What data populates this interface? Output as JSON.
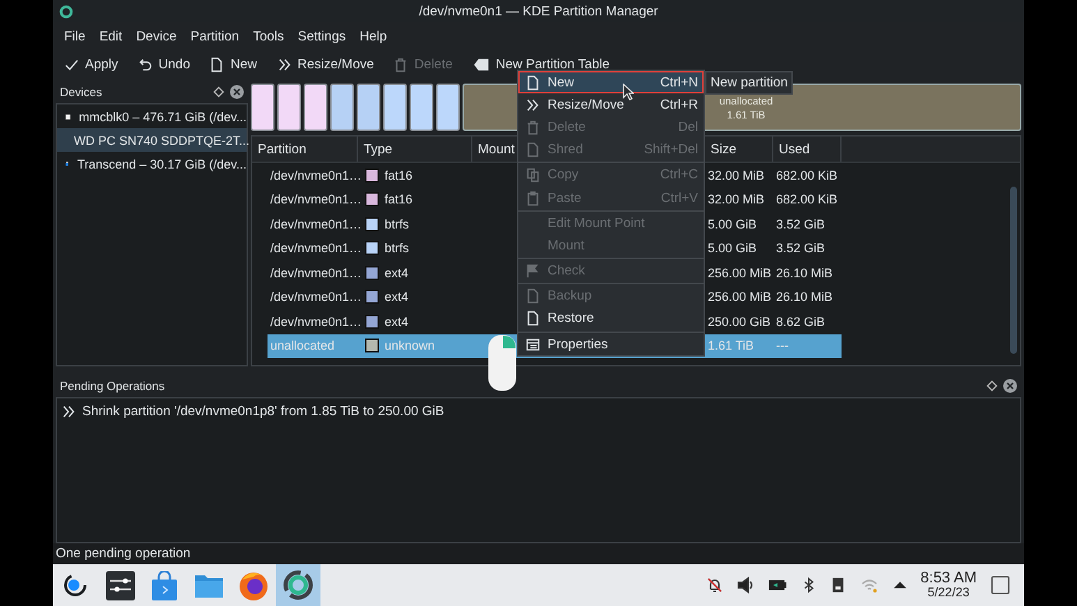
{
  "window": {
    "title": "/dev/nvme0n1 — KDE Partition Manager"
  },
  "menubar": [
    "File",
    "Edit",
    "Device",
    "Partition",
    "Tools",
    "Settings",
    "Help"
  ],
  "toolbar": [
    {
      "label": "Apply",
      "disabled": false
    },
    {
      "label": "Undo",
      "disabled": false
    },
    {
      "label": "New",
      "disabled": false
    },
    {
      "label": "Resize/Move",
      "disabled": false
    },
    {
      "label": "Delete",
      "disabled": true
    },
    {
      "label": "New Partition Table",
      "disabled": false
    }
  ],
  "devices_panel": {
    "title": "Devices",
    "items": [
      {
        "label": "mmcblk0 – 476.71 GiB (/dev...",
        "kind": "disk",
        "selected": false
      },
      {
        "label": "WD PC SN740 SDDPTQE-2T...",
        "kind": "disk",
        "selected": true
      },
      {
        "label": "Transcend – 30.17 GiB (/dev...",
        "kind": "usb",
        "selected": false
      }
    ]
  },
  "partition_bar": {
    "segments": [
      {
        "kind": "partition",
        "color": "#f2d9f7"
      },
      {
        "kind": "partition",
        "color": "#f2d9f7"
      },
      {
        "kind": "partition",
        "color": "#f2d9f7"
      },
      {
        "kind": "partition",
        "color": "#b6d1f5"
      },
      {
        "kind": "partition",
        "color": "#b6d1f5"
      },
      {
        "kind": "partition",
        "color": "#bcd7fb"
      },
      {
        "kind": "partition",
        "color": "#bcd7fb"
      },
      {
        "kind": "partition",
        "color": "#bcd7fb"
      },
      {
        "kind": "unallocated",
        "color": "#7a735e",
        "label": "unallocated",
        "size": "1.61 TiB"
      }
    ]
  },
  "table": {
    "columns": [
      "Partition",
      "Type",
      "Mount",
      "Size",
      "Used"
    ],
    "rows": [
      {
        "partition": "/dev/nvme0n1…",
        "type": "fat16",
        "color": "#d9b8dd",
        "size": "32.00 MiB",
        "used": "682.00 KiB",
        "selected": false
      },
      {
        "partition": "/dev/nvme0n1…",
        "type": "fat16",
        "color": "#d9b8dd",
        "size": "32.00 MiB",
        "used": "682.00 KiB",
        "selected": false
      },
      {
        "partition": "/dev/nvme0n1…",
        "type": "btrfs",
        "color": "#b9d3f7",
        "size": "5.00 GiB",
        "used": "3.52 GiB",
        "selected": false
      },
      {
        "partition": "/dev/nvme0n1…",
        "type": "btrfs",
        "color": "#b9d3f7",
        "size": "5.00 GiB",
        "used": "3.52 GiB",
        "selected": false
      },
      {
        "partition": "/dev/nvme0n1…",
        "type": "ext4",
        "color": "#94a6d4",
        "size": "256.00 MiB",
        "used": "26.10 MiB",
        "selected": false
      },
      {
        "partition": "/dev/nvme0n1…",
        "type": "ext4",
        "color": "#94a6d4",
        "size": "256.00 MiB",
        "used": "26.10 MiB",
        "selected": false
      },
      {
        "partition": "/dev/nvme0n1…",
        "type": "ext4",
        "color": "#94a6d4",
        "size": "250.00 GiB",
        "used": "8.62 GiB",
        "selected": false
      },
      {
        "partition": "unallocated",
        "type": "unknown",
        "color": "#b4b8ae",
        "size": "1.61 TiB",
        "used": "---",
        "selected": true
      }
    ]
  },
  "context_menu": {
    "items": [
      {
        "kind": "item",
        "label": "New",
        "shortcut": "Ctrl+N",
        "disabled": false,
        "selected": true
      },
      {
        "kind": "item",
        "label": "Resize/Move",
        "shortcut": "Ctrl+R",
        "disabled": false,
        "selected": false
      },
      {
        "kind": "item",
        "label": "Delete",
        "shortcut": "Del",
        "disabled": true,
        "selected": false
      },
      {
        "kind": "item",
        "label": "Shred",
        "shortcut": "Shift+Del",
        "disabled": true,
        "selected": false
      },
      {
        "kind": "separator"
      },
      {
        "kind": "item",
        "label": "Copy",
        "shortcut": "Ctrl+C",
        "disabled": true,
        "selected": false
      },
      {
        "kind": "item",
        "label": "Paste",
        "shortcut": "Ctrl+V",
        "disabled": true,
        "selected": false
      },
      {
        "kind": "separator"
      },
      {
        "kind": "item",
        "label": "Edit Mount Point",
        "disabled": true,
        "selected": false
      },
      {
        "kind": "item",
        "label": "Mount",
        "disabled": true,
        "selected": false
      },
      {
        "kind": "separator"
      },
      {
        "kind": "item",
        "label": "Check",
        "disabled": true,
        "selected": false
      },
      {
        "kind": "separator"
      },
      {
        "kind": "item",
        "label": "Backup",
        "disabled": true,
        "selected": false
      },
      {
        "kind": "item",
        "label": "Restore",
        "disabled": false,
        "selected": false
      },
      {
        "kind": "separator"
      },
      {
        "kind": "item",
        "label": "Properties",
        "disabled": false,
        "selected": false
      }
    ]
  },
  "tooltip": "New partition",
  "pending_operations": {
    "title": "Pending Operations",
    "items": [
      "Shrink partition '/dev/nvme0n1p8' from 1.85 TiB to 250.00 GiB"
    ]
  },
  "status_bar": "One pending operation",
  "taskbar": {
    "apps": [
      {
        "selected": false
      },
      {
        "selected": false
      },
      {
        "selected": false
      },
      {
        "selected": false
      },
      {
        "selected": false
      },
      {
        "selected": true
      }
    ],
    "clock": {
      "time": "8:53 AM",
      "date": "5/22/23"
    }
  }
}
